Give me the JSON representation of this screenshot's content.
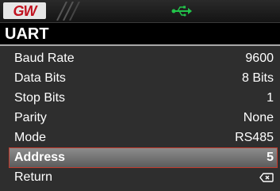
{
  "header": {
    "logo_text": "GW",
    "usb_icon": "usb-icon",
    "usb_color": "#22c44a"
  },
  "title": "UART",
  "menu": {
    "items": [
      {
        "label": "Baud Rate",
        "value": "9600"
      },
      {
        "label": "Data Bits",
        "value": "8 Bits"
      },
      {
        "label": "Stop Bits",
        "value": "1"
      },
      {
        "label": "Parity",
        "value": "None"
      },
      {
        "label": "Mode",
        "value": "RS485"
      },
      {
        "label": "Address",
        "value": "5",
        "selected": true
      },
      {
        "label": "Return",
        "icon": "return-icon"
      }
    ]
  },
  "colors": {
    "selection_outline": "#c0392b",
    "menu_bg": "#2e2e2e"
  }
}
